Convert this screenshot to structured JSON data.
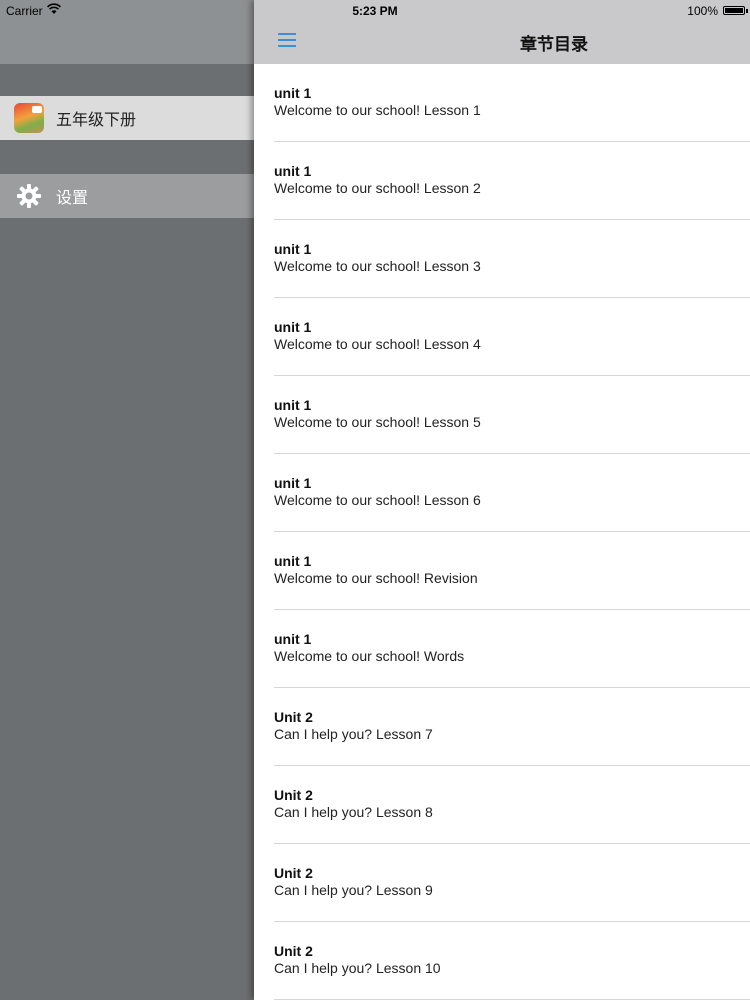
{
  "status_bar": {
    "carrier": "Carrier",
    "time": "5:23 PM",
    "battery": "100%"
  },
  "drawer": {
    "items": [
      {
        "label": "五年级下册",
        "icon": "book-cover-icon"
      },
      {
        "label": "设置",
        "icon": "gear-icon"
      }
    ]
  },
  "navbar": {
    "title": "章节目录",
    "menu_icon": "hamburger-menu-icon",
    "accent": "#3d8fd8"
  },
  "chapters": [
    {
      "unit": "unit 1",
      "title": "Welcome to our school! Lesson 1"
    },
    {
      "unit": "unit 1",
      "title": "Welcome to our school! Lesson 2"
    },
    {
      "unit": "unit 1",
      "title": "Welcome to our school! Lesson 3"
    },
    {
      "unit": "unit 1",
      "title": "Welcome to our school! Lesson 4"
    },
    {
      "unit": "unit 1",
      "title": "Welcome to our school! Lesson 5"
    },
    {
      "unit": "unit 1",
      "title": "Welcome to our school! Lesson 6"
    },
    {
      "unit": "unit 1",
      "title": "Welcome to our school! Revision"
    },
    {
      "unit": "unit 1",
      "title": "Welcome to our school! Words"
    },
    {
      "unit": "Unit 2",
      "title": "Can I help you? Lesson 7"
    },
    {
      "unit": "Unit 2",
      "title": "Can I help you? Lesson 8"
    },
    {
      "unit": "Unit 2",
      "title": "Can I help you? Lesson 9"
    },
    {
      "unit": "Unit 2",
      "title": "Can I help you? Lesson 10"
    }
  ]
}
